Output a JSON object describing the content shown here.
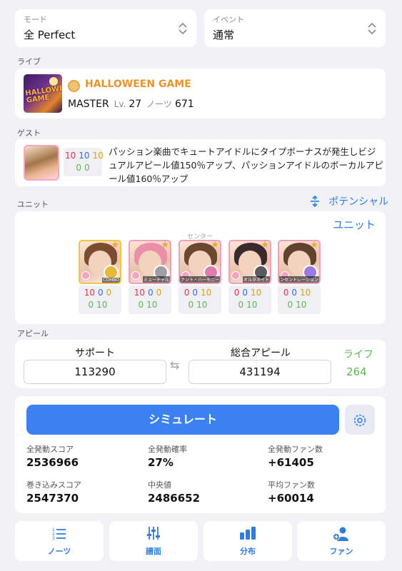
{
  "mode": {
    "label": "モード",
    "value": "全 Perfect"
  },
  "event": {
    "label": "イベント",
    "value": "通常"
  },
  "live": {
    "section": "ライブ",
    "title": "HALLOWEEN GAME",
    "difficulty": "MASTER",
    "level_label": "Lv.",
    "level": "27",
    "notes_label": "ノーツ",
    "notes": "671",
    "jacket_text": "HALLOWEEN GAME"
  },
  "guest": {
    "section": "ゲスト",
    "potential": {
      "vo": "10",
      "da": "10",
      "vi": "10",
      "life": "0",
      "skill": "0"
    },
    "description": "パッション楽曲でキュートアイドルにタイプボーナスが発生しビジュアルアピール値150％アップ、パッションアイドルのボーカルアピール値160％アップ"
  },
  "unit": {
    "section": "ユニット",
    "potential_link": "ポテンシャル",
    "title": "ユニット",
    "center_label": "センター",
    "members": [
      {
        "skill": "COMBO",
        "vo": "10",
        "da": "0",
        "vi": "0",
        "life": "0",
        "skill_pot": "10",
        "frame": "#f2c640",
        "hair": "#7a4d2e",
        "skill_color": "#e8b63a"
      },
      {
        "skill": "ミューチャル",
        "vo": "10",
        "da": "0",
        "vi": "0",
        "life": "0",
        "skill_pot": "10",
        "frame": "#f0a0bd",
        "hair": "#e98fa8",
        "skill_color": "#9e9ea3"
      },
      {
        "skill": "ドミナント・ハーモニー",
        "vo": "0",
        "da": "0",
        "vi": "10",
        "life": "0",
        "skill_pot": "10",
        "frame": "#f0a0bd",
        "hair": "#6b4730",
        "skill_color": "#e37cae"
      },
      {
        "skill": "オルタネイト",
        "vo": "0",
        "da": "0",
        "vi": "10",
        "life": "0",
        "skill_pot": "10",
        "frame": "#f0a0bd",
        "hair": "#3a2a2e",
        "skill_color": "#5a5a60"
      },
      {
        "skill": "コンセントレーション",
        "vo": "0",
        "da": "0",
        "vi": "10",
        "life": "0",
        "skill_pot": "10",
        "frame": "#f0a0bd",
        "hair": "#5f432e",
        "skill_color": "#9c7ae0"
      }
    ]
  },
  "appeal": {
    "section": "アピール",
    "support_label": "サポート",
    "support_value": "113290",
    "total_label": "総合アピール",
    "total_value": "431194",
    "life_label": "ライフ",
    "life_value": "264"
  },
  "simulation": {
    "button": "シミュレート",
    "stats": [
      {
        "label": "全発動スコア",
        "value": "2536966"
      },
      {
        "label": "全発動確率",
        "value": "27%"
      },
      {
        "label": "全発動ファン数",
        "value": "+61405"
      },
      {
        "label": "巻き込みスコア",
        "value": "2547370"
      },
      {
        "label": "中央値",
        "value": "2486652"
      },
      {
        "label": "平均ファン数",
        "value": "+60014"
      }
    ]
  },
  "tabs": [
    {
      "label": "ノーツ",
      "icon": "list-numbered-icon"
    },
    {
      "label": "譜面",
      "icon": "sliders-icon"
    },
    {
      "label": "分布",
      "icon": "bar-chart-icon"
    },
    {
      "label": "ファン",
      "icon": "person-add-icon"
    }
  ],
  "colors": {
    "accent": "#3b82f0",
    "link": "#2f7dd8",
    "life": "#5fb655",
    "song_title": "#e5962b",
    "vocal": "#e0344b",
    "dance": "#2f6fe0",
    "visual": "#d3a319"
  }
}
